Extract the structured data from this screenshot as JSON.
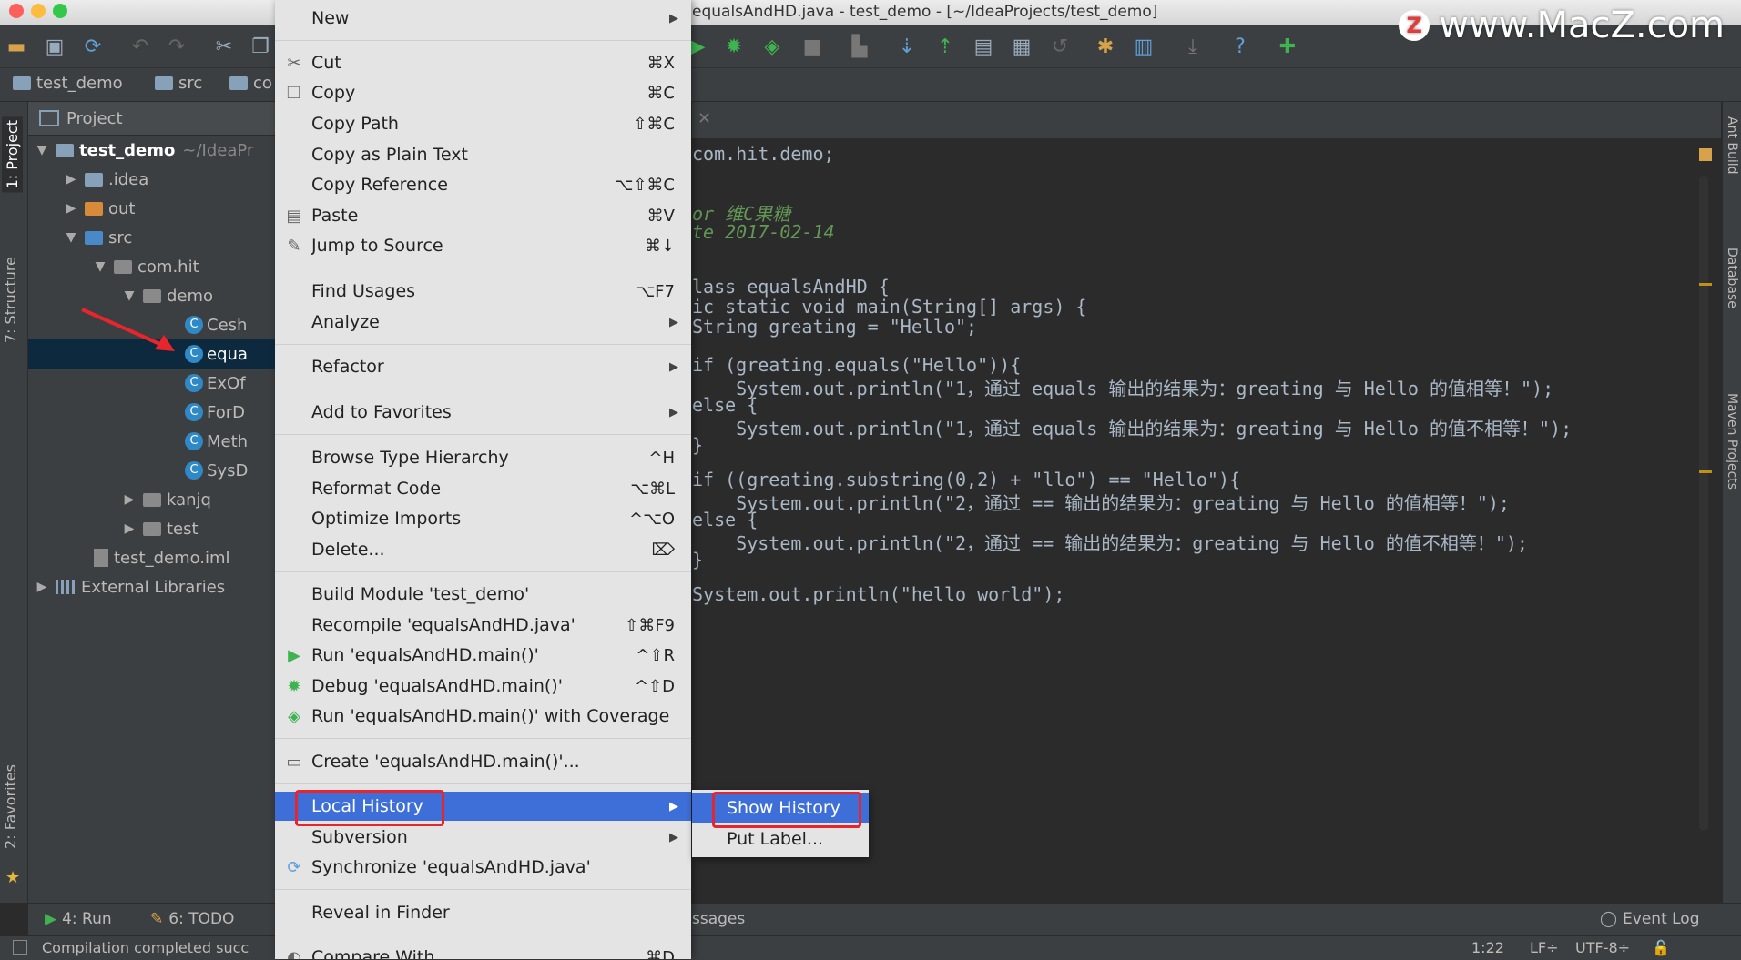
{
  "window": {
    "title": "equalsAndHD.java - test_demo - [~/IdeaProjects/test_demo]",
    "watermark": "www.MacZ.com",
    "watermark_logo": "Z"
  },
  "navbar": {
    "crumbs": [
      "test_demo",
      "src",
      "co"
    ]
  },
  "left_strip": {
    "project_tab": "1: Project",
    "structure_tab": "7: Structure",
    "favorites_tab": "2: Favorites"
  },
  "right_strip": {
    "ant_tab": "Ant Build",
    "database_tab": "Database",
    "maven_tab": "Maven Projects"
  },
  "project": {
    "header": "Project",
    "tree": [
      {
        "label": "test_demo",
        "hint": "~/IdeaPr"
      },
      {
        "label": ".idea"
      },
      {
        "label": "out"
      },
      {
        "label": "src"
      },
      {
        "label": "com.hit"
      },
      {
        "label": "demo"
      },
      {
        "label": "Cesh"
      },
      {
        "label": "equa"
      },
      {
        "label": "ExOf"
      },
      {
        "label": "ForD"
      },
      {
        "label": "Meth"
      },
      {
        "label": "SysD"
      },
      {
        "label": "kanjq"
      },
      {
        "label": "test"
      },
      {
        "label": "test_demo.iml"
      },
      {
        "label": "External Libraries"
      }
    ]
  },
  "context_menu": {
    "items": [
      {
        "label": "New",
        "shortcut": "",
        "submenu": true,
        "icon": ""
      },
      {
        "label": "Cut",
        "shortcut": "⌘X",
        "icon": "scissors-icon"
      },
      {
        "label": "Copy",
        "shortcut": "⌘C",
        "icon": "copy-icon"
      },
      {
        "label": "Copy Path",
        "shortcut": "⇧⌘C"
      },
      {
        "label": "Copy as Plain Text",
        "shortcut": ""
      },
      {
        "label": "Copy Reference",
        "shortcut": "⌥⇧⌘C"
      },
      {
        "label": "Paste",
        "shortcut": "⌘V",
        "icon": "paste-icon"
      },
      {
        "label": "Jump to Source",
        "shortcut": "⌘↓",
        "icon": "edit-icon"
      },
      {
        "label": "Find Usages",
        "shortcut": "⌥F7"
      },
      {
        "label": "Analyze",
        "submenu": true
      },
      {
        "label": "Refactor",
        "submenu": true
      },
      {
        "label": "Add to Favorites",
        "submenu": true
      },
      {
        "label": "Browse Type Hierarchy",
        "shortcut": "^H"
      },
      {
        "label": "Reformat Code",
        "shortcut": "⌥⌘L"
      },
      {
        "label": "Optimize Imports",
        "shortcut": "^⌥O"
      },
      {
        "label": "Delete...",
        "shortcut": "⌦"
      },
      {
        "label": "Build Module 'test_demo'",
        "shortcut": ""
      },
      {
        "label": "Recompile 'equalsAndHD.java'",
        "shortcut": "⇧⌘F9"
      },
      {
        "label": "Run 'equalsAndHD.main()'",
        "shortcut": "^⇧R",
        "icon": "run-icon"
      },
      {
        "label": "Debug 'equalsAndHD.main()'",
        "shortcut": "^⇧D",
        "icon": "debug-icon"
      },
      {
        "label": "Run 'equalsAndHD.main()' with Coverage",
        "shortcut": "",
        "icon": "coverage-icon"
      },
      {
        "label": "Create 'equalsAndHD.main()'...",
        "shortcut": "",
        "icon": "create-icon"
      },
      {
        "label": "Local History",
        "submenu": true,
        "highlighted": true
      },
      {
        "label": "Subversion",
        "submenu": true
      },
      {
        "label": "Synchronize 'equalsAndHD.java'",
        "icon": "sync-icon"
      },
      {
        "label": "Reveal in Finder"
      },
      {
        "label": "Compare With...",
        "shortcut": "⌘D"
      }
    ]
  },
  "submenu": {
    "items": [
      "Show History",
      "Put Label..."
    ]
  },
  "editor": {
    "lines": [
      "com.hit.demo;",
      "or 维C果糖",
      "te 2017-02-14",
      "lass equalsAndHD {",
      "ic static void main(String[] args) {",
      "String greating = \"Hello\";",
      "if (greating.equals(\"Hello\")){",
      "    System.out.println(\"1，通过 equals 输出的结果为：greating 与 Hello 的值相等！\");",
      "else {",
      "    System.out.println(\"1，通过 equals 输出的结果为：greating 与 Hello 的值不相等！\");",
      "}",
      "if ((greating.substring(0,2) + \"llo\") == \"Hello\"){",
      "    System.out.println(\"2，通过 == 输出的结果为：greating 与 Hello 的值相等！\");",
      "else {",
      "    System.out.println(\"2，通过 == 输出的结果为：greating 与 Hello 的值不相等！\");",
      "}",
      "System.out.println(\"hello world\");"
    ]
  },
  "bottom_tabs": {
    "run": "4: Run",
    "todo": "6: TODO",
    "messages": "ssages",
    "event_log": "Event Log"
  },
  "status": {
    "message": "Compilation completed succ",
    "position": "1:22",
    "line_sep": "LF÷",
    "encoding": "UTF-8÷"
  }
}
